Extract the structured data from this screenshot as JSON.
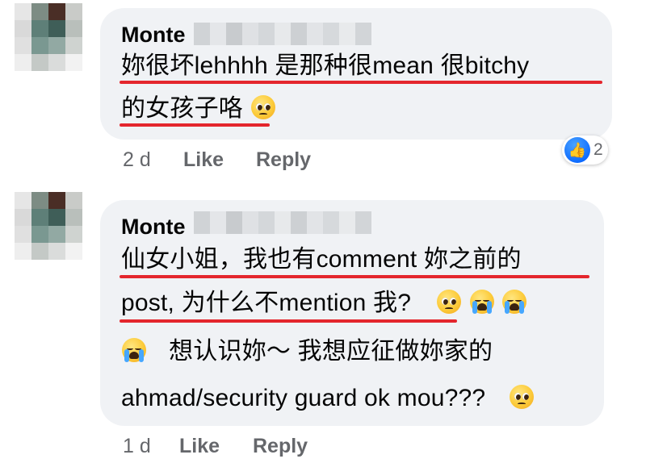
{
  "comments": [
    {
      "author": "Monte",
      "lines": [
        "妳很坏lehhhh 是那种很mean 很bitchy",
        "的女孩子咯"
      ],
      "time": "2 d",
      "like_label": "Like",
      "reply_label": "Reply",
      "reaction_count": "2"
    },
    {
      "author": "Monte",
      "lines": [
        "仙女小姐，我也有comment 妳之前的",
        "post, 为什么不mention 我?",
        "想认识妳～ 我想应征做妳家的",
        "ahmad/security guard ok mou???"
      ],
      "time": "1 d",
      "like_label": "Like",
      "reply_label": "Reply"
    }
  ],
  "icons": {
    "pleading": "pleading-face-icon",
    "crying": "loudly-crying-face-icon",
    "like": "thumbs-up-icon"
  },
  "colors": {
    "bubble": "#f0f2f5",
    "underline": "#e4262d",
    "meta": "#65676b",
    "like": "#0866ff"
  }
}
